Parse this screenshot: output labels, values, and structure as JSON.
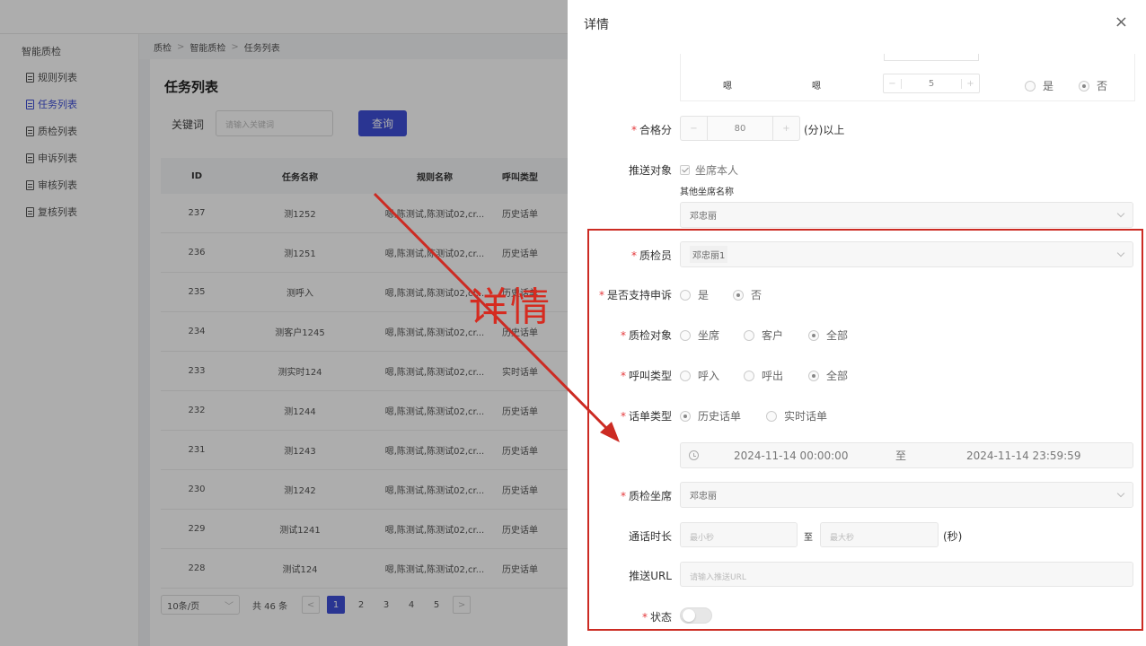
{
  "sidebar": {
    "group": "智能质检",
    "items": [
      {
        "label": "规则列表",
        "active": false
      },
      {
        "label": "任务列表",
        "active": true
      },
      {
        "label": "质检列表",
        "active": false
      },
      {
        "label": "申诉列表",
        "active": false
      },
      {
        "label": "审核列表",
        "active": false
      },
      {
        "label": "复核列表",
        "active": false
      }
    ]
  },
  "breadcrumb": [
    "质检",
    "智能质检",
    "任务列表"
  ],
  "page": {
    "title": "任务列表",
    "keyword_label": "关键词",
    "keyword_placeholder": "请输入关键词",
    "query_button": "查询"
  },
  "table": {
    "headers": [
      "ID",
      "任务名称",
      "规则名称",
      "呼叫类型"
    ],
    "rows": [
      {
        "id": "237",
        "name": "测1252",
        "rule": "嗯,陈测试,陈测试02,cr...",
        "type": "历史话单"
      },
      {
        "id": "236",
        "name": "测1251",
        "rule": "嗯,陈测试,陈测试02,cr...",
        "type": "历史话单"
      },
      {
        "id": "235",
        "name": "测呼入",
        "rule": "嗯,陈测试,陈测试02,cr...",
        "type": "历史话单"
      },
      {
        "id": "234",
        "name": "测客户1245",
        "rule": "嗯,陈测试,陈测试02,cr...",
        "type": "历史话单"
      },
      {
        "id": "233",
        "name": "测实时124",
        "rule": "嗯,陈测试,陈测试02,cr...",
        "type": "实时话单"
      },
      {
        "id": "232",
        "name": "测1244",
        "rule": "嗯,陈测试,陈测试02,cr...",
        "type": "历史话单"
      },
      {
        "id": "231",
        "name": "测1243",
        "rule": "嗯,陈测试,陈测试02,cr...",
        "type": "历史话单"
      },
      {
        "id": "230",
        "name": "测1242",
        "rule": "嗯,陈测试,陈测试02,cr...",
        "type": "历史话单"
      },
      {
        "id": "229",
        "name": "测试1241",
        "rule": "嗯,陈测试,陈测试02,cr...",
        "type": "历史话单"
      },
      {
        "id": "228",
        "name": "测试124",
        "rule": "嗯,陈测试,陈测试02,cr...",
        "type": "历史话单"
      }
    ]
  },
  "pagination": {
    "page_size": "10条/页",
    "total": "共 46 条",
    "pages": [
      "1",
      "2",
      "3",
      "4",
      "5"
    ],
    "current": "1",
    "prev": "<",
    "next": ">"
  },
  "drawer": {
    "title": "详情",
    "close": "×",
    "rule_row": {
      "col1": "嗯",
      "col2": "嗯",
      "score": "5",
      "yes": "是",
      "no": "否",
      "minus": "−",
      "plus": "+"
    },
    "pass_score": {
      "label": "合格分",
      "value": "80",
      "suffix": "(分)以上",
      "minus": "−",
      "plus": "+"
    },
    "push_target": {
      "label": "推送对象",
      "checkbox": "坐席本人",
      "other_label": "其他坐席名称",
      "other_value": "邓忠丽"
    },
    "inspector": {
      "label": "质检员",
      "value": "邓忠丽1"
    },
    "appeal": {
      "label": "是否支持申诉",
      "options": [
        "是",
        "否"
      ],
      "selected": "否"
    },
    "target": {
      "label": "质检对象",
      "options": [
        "坐席",
        "客户",
        "全部"
      ],
      "selected": "全部"
    },
    "call_type": {
      "label": "呼叫类型",
      "options": [
        "呼入",
        "呼出",
        "全部"
      ],
      "selected": "全部"
    },
    "bill_type": {
      "label": "话单类型",
      "options": [
        "历史话单",
        "实时话单"
      ],
      "selected": "历史话单"
    },
    "date_range": {
      "start": "2024-11-14 00:00:00",
      "sep": "至",
      "end": "2024-11-14 23:59:59"
    },
    "agent": {
      "label": "质检坐席",
      "value": "邓忠丽"
    },
    "duration": {
      "label": "通话时长",
      "min_placeholder": "最小秒",
      "sep": "至",
      "max_placeholder": "最大秒",
      "suffix": "(秒)"
    },
    "push_url": {
      "label": "推送URL",
      "placeholder": "请输入推送URL"
    },
    "status": {
      "label": "状态",
      "on": false
    }
  },
  "annotation": {
    "text": "详情",
    "color": "#cc2b23"
  },
  "colors": {
    "primary": "#3f4fd8",
    "required": "#e4393c",
    "annotation": "#cc2b23"
  }
}
